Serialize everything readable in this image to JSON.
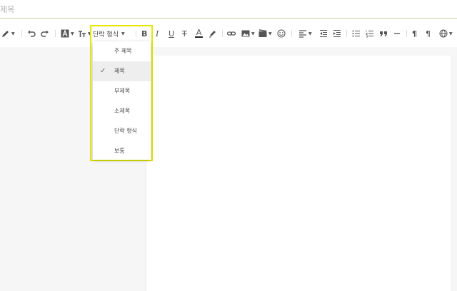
{
  "title_field": {
    "placeholder": "제목",
    "value": ""
  },
  "toolbar": {
    "paragraph_format_label": "단락 형식",
    "bold_label": "B",
    "italic_label": "I",
    "underline_label": "U",
    "strike_label": "T",
    "font_color_label": "A",
    "pilcrow_label": "¶"
  },
  "dropdown": {
    "items": [
      {
        "label": "주 제목",
        "selected": false
      },
      {
        "label": "제목",
        "selected": true
      },
      {
        "label": "부제목",
        "selected": false
      },
      {
        "label": "소제목",
        "selected": false
      },
      {
        "label": "단락 형식",
        "selected": false
      },
      {
        "label": "보통",
        "selected": false
      }
    ],
    "check_glyph": "✓"
  },
  "colors": {
    "highlight": "#e6e600",
    "selected_bg": "#eeeeee",
    "title_underline": "#cfcfa0"
  }
}
